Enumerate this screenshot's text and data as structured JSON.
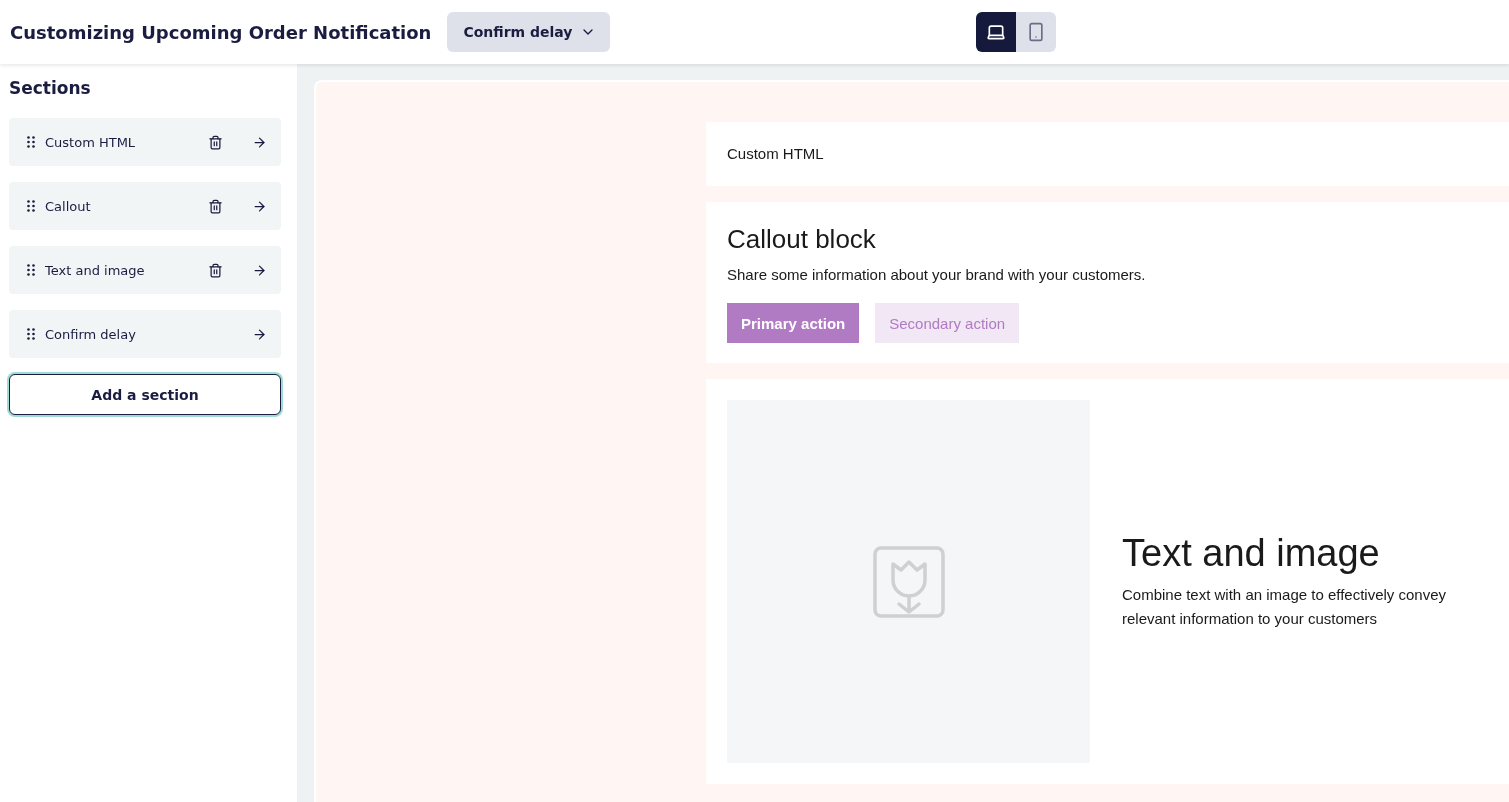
{
  "header": {
    "title": "Customizing Upcoming Order Notification",
    "dropdown": "Confirm delay",
    "devices": [
      {
        "kind": "desktop",
        "selected": true
      },
      {
        "kind": "mobile",
        "selected": false
      }
    ]
  },
  "sidebar": {
    "title": "Sections",
    "items": [
      {
        "label": "Custom HTML",
        "deletable": true
      },
      {
        "label": "Callout",
        "deletable": true
      },
      {
        "label": "Text and image",
        "deletable": true
      },
      {
        "label": "Confirm delay",
        "deletable": false
      }
    ],
    "add_button": "Add a section"
  },
  "preview": {
    "blocks": [
      {
        "kind": "html",
        "text": "Custom HTML"
      },
      {
        "kind": "callout",
        "title": "Callout block",
        "text": "Share some information about your brand with your customers.",
        "primary": "Primary action",
        "secondary": "Secondary action"
      },
      {
        "kind": "text_image",
        "title": "Text and image",
        "text": "Combine text with an image to effectively convey relevant information to your customers"
      }
    ]
  }
}
